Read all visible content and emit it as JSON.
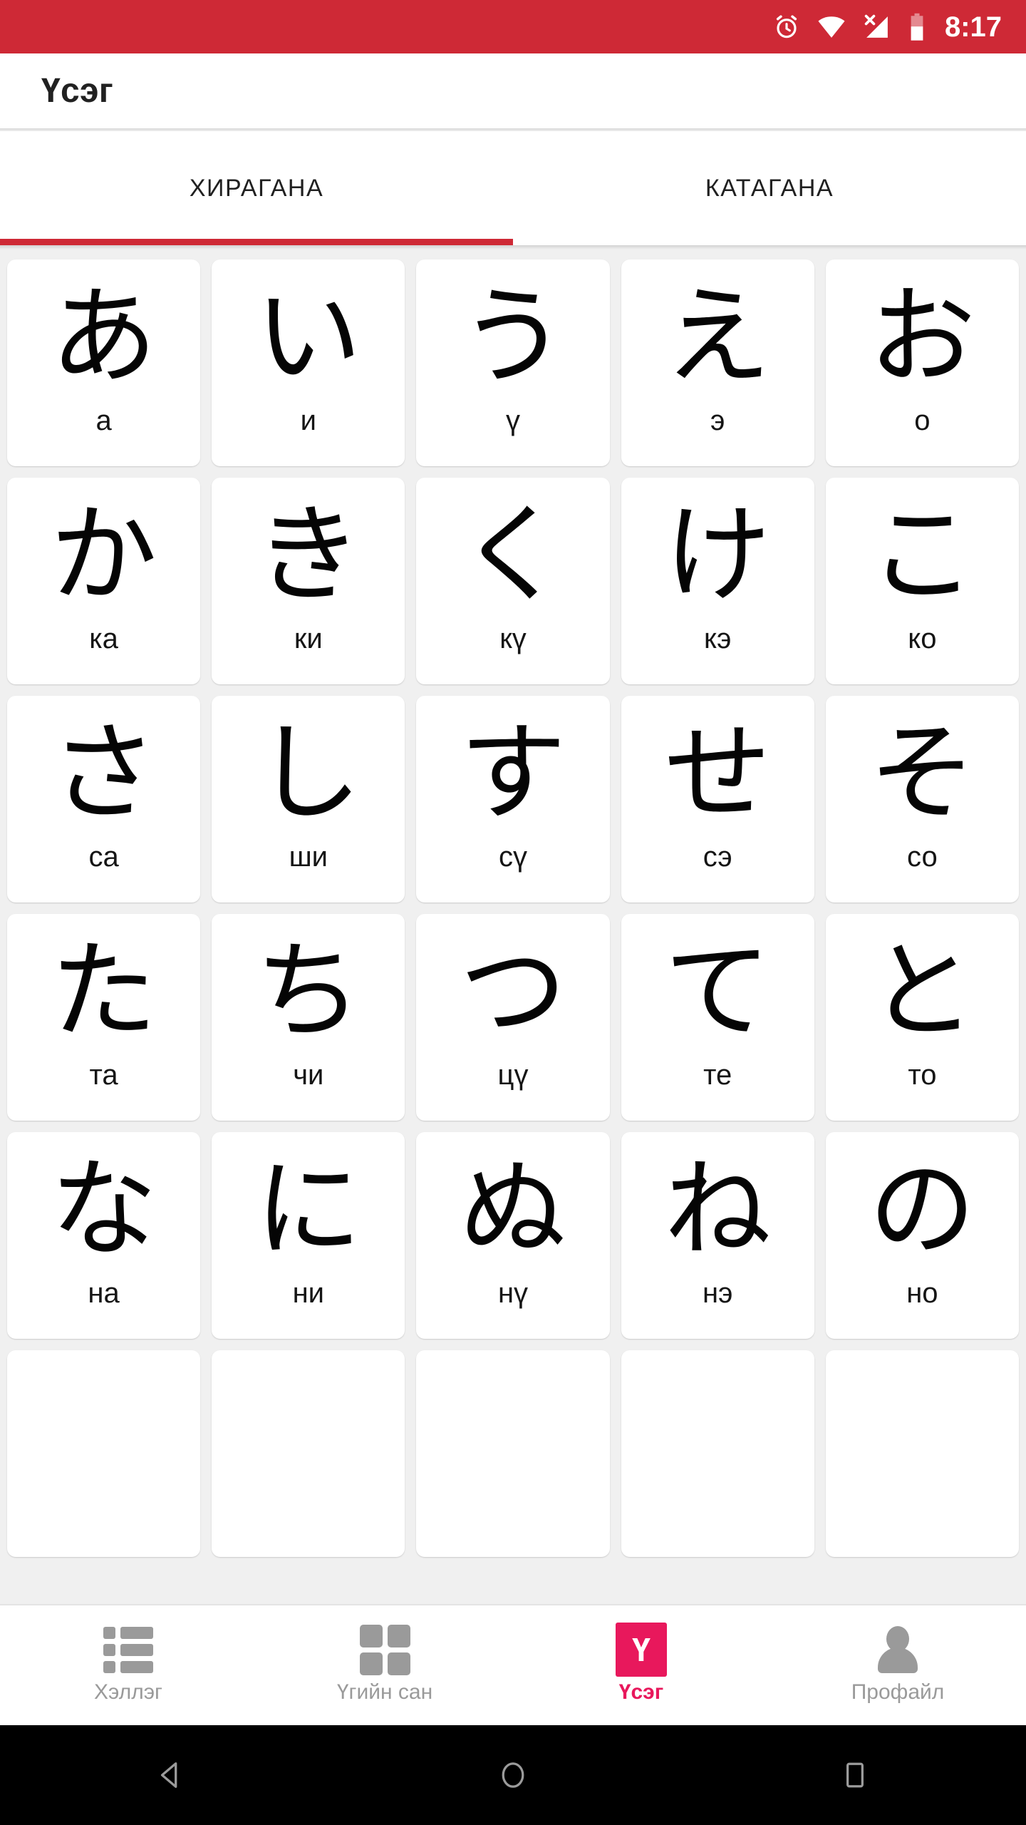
{
  "status_bar": {
    "time": "8:17",
    "icons": [
      "alarm-icon",
      "wifi-icon",
      "signal-no-sim-icon",
      "battery-icon"
    ],
    "background_color": "#CE2936"
  },
  "app_bar": {
    "title": "Үсэг"
  },
  "tabs": {
    "items": [
      {
        "label": "ХИРАГАНА",
        "active": true
      },
      {
        "label": "КАТАГАНА",
        "active": false
      }
    ],
    "indicator_color": "#CE2936"
  },
  "kana_grid": {
    "columns": 5,
    "cards": [
      {
        "kana": "あ",
        "label": "а"
      },
      {
        "kana": "い",
        "label": "и"
      },
      {
        "kana": "う",
        "label": "ү"
      },
      {
        "kana": "え",
        "label": "э"
      },
      {
        "kana": "お",
        "label": "о"
      },
      {
        "kana": "か",
        "label": "ка"
      },
      {
        "kana": "き",
        "label": "ки"
      },
      {
        "kana": "く",
        "label": "кү"
      },
      {
        "kana": "け",
        "label": "кэ"
      },
      {
        "kana": "こ",
        "label": "ко"
      },
      {
        "kana": "さ",
        "label": "са"
      },
      {
        "kana": "し",
        "label": "ши"
      },
      {
        "kana": "す",
        "label": "сү"
      },
      {
        "kana": "せ",
        "label": "сэ"
      },
      {
        "kana": "そ",
        "label": "со"
      },
      {
        "kana": "た",
        "label": "та"
      },
      {
        "kana": "ち",
        "label": "чи"
      },
      {
        "kana": "つ",
        "label": "цү"
      },
      {
        "kana": "て",
        "label": "те"
      },
      {
        "kana": "と",
        "label": "то"
      },
      {
        "kana": "な",
        "label": "на"
      },
      {
        "kana": "に",
        "label": "ни"
      },
      {
        "kana": "ぬ",
        "label": "нү"
      },
      {
        "kana": "ね",
        "label": "нэ"
      },
      {
        "kana": "の",
        "label": "но"
      },
      {
        "kana": "",
        "label": ""
      },
      {
        "kana": "",
        "label": ""
      },
      {
        "kana": "",
        "label": ""
      },
      {
        "kana": "",
        "label": ""
      },
      {
        "kana": "",
        "label": ""
      }
    ]
  },
  "bottom_nav": {
    "accent_color": "#E8185C",
    "inactive_color": "#9A9A9A",
    "items": [
      {
        "label": "Хэллэг",
        "icon": "list-icon",
        "active": false
      },
      {
        "label": "Үгийн сан",
        "icon": "grid-icon",
        "active": false
      },
      {
        "label": "Үсэг",
        "icon": "letter-badge-icon",
        "badge_text": "Ү",
        "active": true
      },
      {
        "label": "Профайл",
        "icon": "person-icon",
        "active": false
      }
    ]
  },
  "system_nav": {
    "buttons": [
      "back-icon",
      "home-icon",
      "recents-icon"
    ]
  }
}
